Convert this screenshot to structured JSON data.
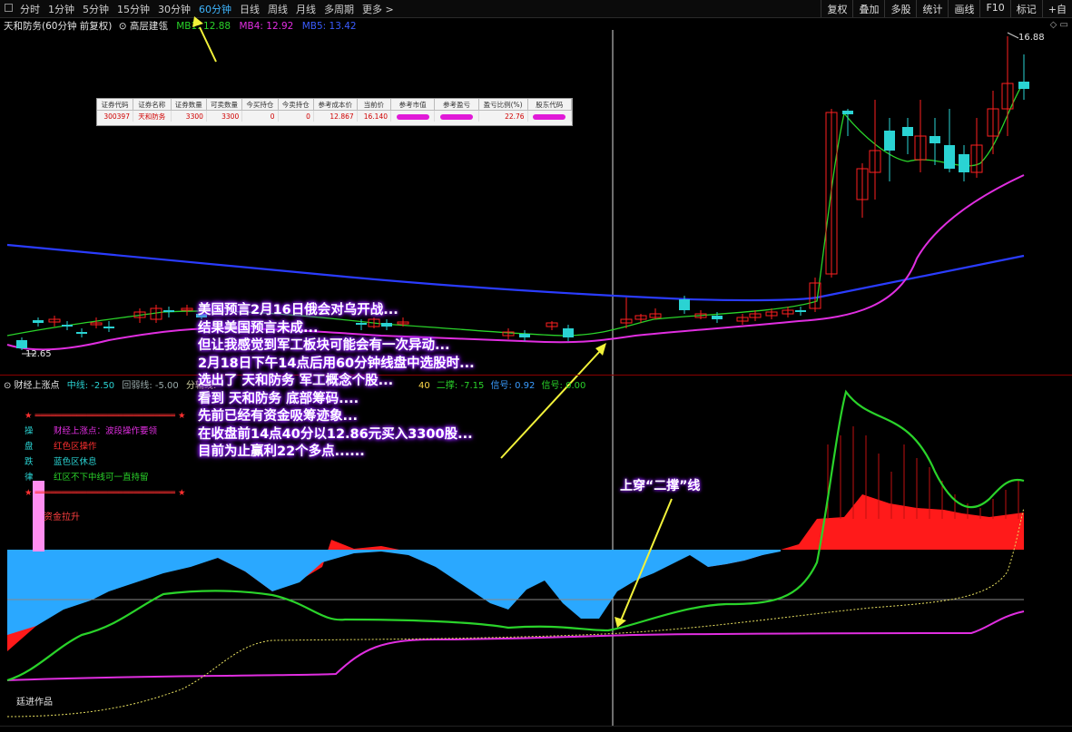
{
  "toolbar": {
    "tabs": [
      "分时",
      "1分钟",
      "5分钟",
      "15分钟",
      "30分钟",
      "60分钟",
      "日线",
      "周线",
      "月线",
      "多周期",
      "更多 >"
    ],
    "active_index": 5,
    "right_items": [
      "复权",
      "叠加",
      "多股",
      "统计",
      "画线",
      "F10",
      "标记",
      "+自"
    ]
  },
  "chart_title": {
    "name": "天和防务(60分钟 前复权)",
    "indicator": "⊙ 高层建瓴",
    "mb1": "MB1: 12.88",
    "mb4": "MB4: 12.92",
    "mb5": "MB5: 13.42"
  },
  "position_table": {
    "headers": [
      "证券代码",
      "证券名称",
      "证券数量",
      "可卖数量",
      "今买持仓",
      "今卖持仓",
      "参考成本价",
      "当前价",
      "参考市值",
      "参考盈亏",
      "盈亏比例(%)",
      "股东代码"
    ],
    "row": [
      "300397",
      "天和防务",
      "3300",
      "3300",
      "0",
      "0",
      "12.867",
      "16.140",
      "",
      "",
      "22.76",
      ""
    ]
  },
  "price_labels": {
    "high": "16.88",
    "low": "12.65"
  },
  "indicator_title": {
    "name": "⊙ 财经上涨点",
    "a": "中线: -2.50",
    "b": "回弱线: -5.00",
    "c": "分辅线:",
    "d": "40",
    "e": "二撑: -7.15",
    "f": "信号: 0.92",
    "g": "信号: 0.00"
  },
  "legend": {
    "stars": "★ ═══════════════════════════ ★",
    "rows": [
      {
        "k": "操",
        "v": "财经上涨点：波段操作要领",
        "c": "#e02ee0"
      },
      {
        "k": "盘",
        "v": "红色区操作",
        "c": "#ff3030"
      },
      {
        "k": "跌",
        "v": "蓝色区休息",
        "c": "#2ad3d3"
      },
      {
        "k": "律",
        "v": "红区不下中线可一直持留",
        "c": "#2ad32a"
      }
    ],
    "fund_label": "资金拉升"
  },
  "overlay_text": [
    "美国预言2月16日俄会对乌开战...",
    "结果美国预言未成...",
    "但让我感觉到军工板块可能会有一次异动...",
    "2月18日下午14点后用60分钟线盘中选股时...",
    "选出了 天和防务 军工概念个股...",
    "看到 天和防务 底部筹码....",
    "先前已经有资金吸筹迹象...",
    "在收盘前14点40分以12.86元买入3300股...",
    "目前为止赢利22个多点......"
  ],
  "annotation2": "上穿“二撑”线",
  "watermark": "廷进作品",
  "colors": {
    "up": "#ff2020",
    "down": "#2ad3d3",
    "ma_green": "#2ad32a",
    "ma_magenta": "#e02ee0",
    "ma_blue": "#2a3cff",
    "highlight": "#9020ff",
    "arrow": "#f2f23a"
  },
  "chart_data": {
    "type": "candlestick",
    "price_high": 16.88,
    "price_low": 12.65,
    "last_close": 16.14
  }
}
